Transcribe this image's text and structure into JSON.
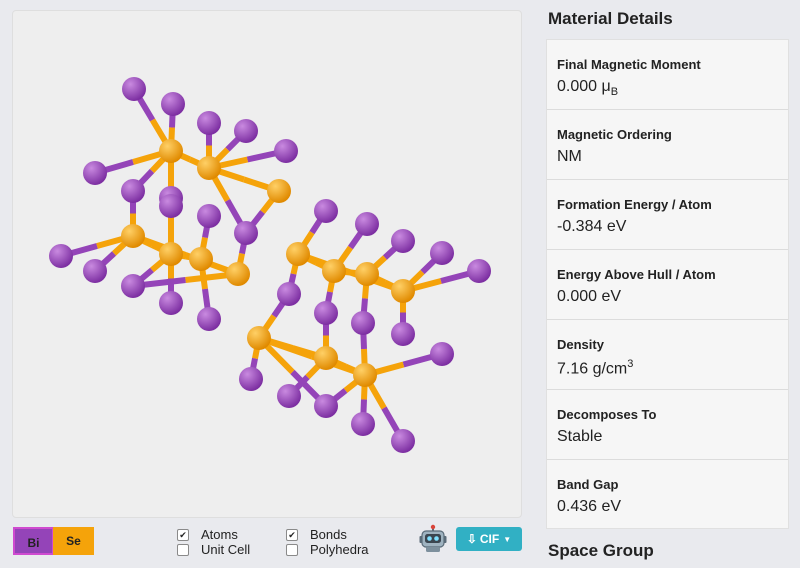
{
  "legend": [
    {
      "label": "Bi",
      "color": "#9444b8"
    },
    {
      "label": "Se",
      "color": "#f5a30a"
    }
  ],
  "options": {
    "atoms": {
      "label": "Atoms",
      "checked": true
    },
    "unit_cell": {
      "label": "Unit Cell",
      "checked": false
    },
    "bonds": {
      "label": "Bonds",
      "checked": true
    },
    "polyhedra": {
      "label": "Polyhedra",
      "checked": false
    }
  },
  "robot_icon": "robot-icon",
  "download": {
    "label": "CIF",
    "icon": "download-icon"
  },
  "panel": {
    "title": "Material Details",
    "properties": [
      {
        "label": "Final Magnetic Moment",
        "value": "0.000 μ",
        "sub": "B"
      },
      {
        "label": "Magnetic Ordering",
        "value": "NM"
      },
      {
        "label": "Formation Energy / Atom",
        "value": "-0.384 eV"
      },
      {
        "label": "Energy Above Hull / Atom",
        "value": "0.000 eV"
      },
      {
        "label": "Density",
        "value": "7.16 g/cm",
        "sup": "3"
      },
      {
        "label": "Decomposes To",
        "value": "Stable"
      },
      {
        "label": "Band Gap",
        "value": "0.436 eV"
      }
    ],
    "next_section": "Space Group"
  },
  "colors": {
    "bi": "#9444b8",
    "se": "#f5a30a",
    "cif_button": "#31b0c4"
  }
}
